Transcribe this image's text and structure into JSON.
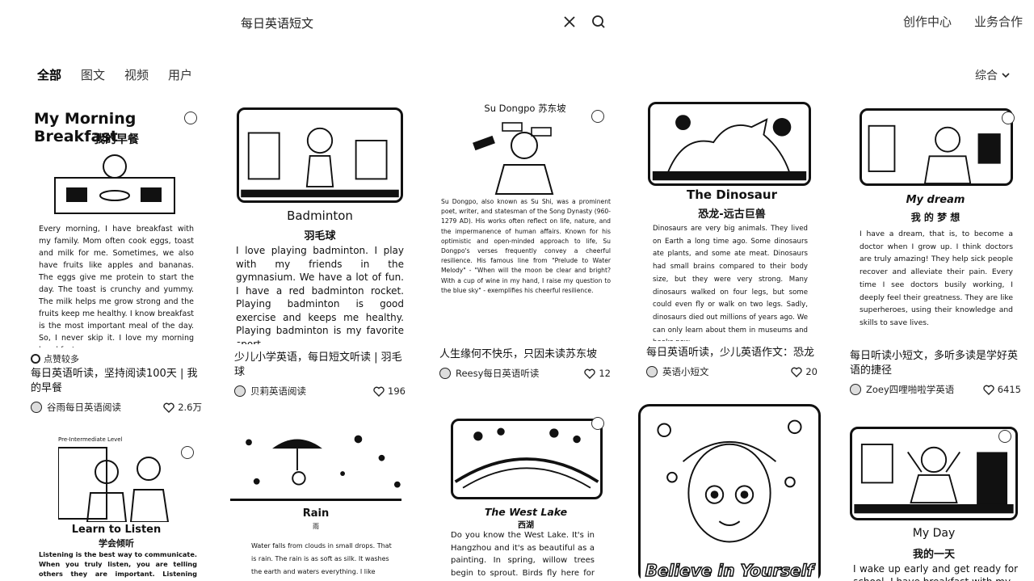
{
  "search": {
    "query": "每日英语短文"
  },
  "header_links": [
    "创作中心",
    "业务合作"
  ],
  "tabs": [
    "全部",
    "图文",
    "视频",
    "用户"
  ],
  "sort": "综合",
  "cards": [
    {
      "img_title": "My Morning Breakfast",
      "img_subtitle": "我的早餐",
      "img_text": "Every morning, I have breakfast with my family. Mom often cook eggs, toast and milk for me. Sometimes, we also have fruits like apples and bananas. The eggs give me protein to start the day. The toast is crunchy and yummy. The milk helps me grow strong and the fruits keep me healthy. I know breakfast is the most important meal of the day. So, I never skip it. I love my morning breakfast.",
      "badge": "点赞较多",
      "caption": "每日英语听读，坚持阅读100天 | 我的早餐",
      "author": "谷雨每日英语阅读",
      "likes": "2.6万"
    },
    {
      "img_title": "Badminton",
      "img_subtitle": "羽毛球",
      "img_text": "I love playing badminton. I play with my friends in the gymnasium. We have a lot of fun. I have a red badminton rocket. Playing badminton is good exercise and keeps me healthy. Playing badminton is my favorite sport.",
      "caption": "少儿小学英语，每日短文听读 | 羽毛球",
      "author": "贝莉英语阅读",
      "likes": "196"
    },
    {
      "img_title": "Su Dongpo  苏东坡",
      "img_text": "Su Dongpo, also known as Su Shi, was a prominent poet, writer, and statesman of the Song Dynasty (960-1279 AD). His works often reflect on life, nature, and the impermanence of human affairs. Known for his optimistic and open-minded approach to life, Su Dongpo's verses frequently convey a cheerful resilience. His famous line from \"Prelude to Water Melody\" - \"When will the moon be clear and bright? With a cup of wine in my hand, I raise my question to the blue sky\" - exemplifies his cheerful resilience.",
      "caption": "人生缘何不快乐，只因未读苏东坡",
      "author": "Reesy每日英语听读",
      "likes": "12"
    },
    {
      "img_title": "The Dinosaur",
      "img_subtitle": "恐龙-远古巨兽",
      "img_text": "Dinosaurs are very big animals. They lived on Earth a long time ago. Some dinosaurs ate plants, and some ate meat. Dinosaurs had small brains compared to their body size, but they were very strong. Many dinosaurs walked on four legs, but some could even fly or walk on two legs. Sadly, dinosaurs died out millions of years ago. We can only learn about them in museums and books now.",
      "caption": "每日英语听读，少儿英语作文：恐龙",
      "author": "英语小短文",
      "likes": "20"
    },
    {
      "img_title": "My dream",
      "img_subtitle": "我 的 梦 想",
      "img_text": "I have a dream, that is, to become a doctor when I grow up. I think doctors are truly amazing! They help sick people recover and alleviate their pain. Every time I see doctors busily working, I deeply feel their greatness. They are like superheroes, using their knowledge and skills to save lives.",
      "caption": "每日听读小短文，多听多读是学好英语的捷径",
      "author": "Zoey四哩啪啦学英语",
      "likes": "6415"
    },
    {
      "img_top": "Pre-Intermediate Level",
      "img_title": "Learn to Listen",
      "img_subtitle": "学会倾听",
      "img_text": "Listening is the best way to communicate. When you truly listen, you are telling others they are important. Listening helps you understand"
    },
    {
      "img_title": "Rain",
      "img_subtitle": "雨",
      "img_text": "Water falls from clouds in small drops. That is rain. The rain is as soft as silk. It washes the earth and waters everything. I like"
    },
    {
      "img_title": "The West Lake",
      "img_subtitle": "西湖",
      "img_text": "Do you know the West Lake. It's in Hangzhou and it's as beautiful as a painting. In spring, willow trees begin to sprout. Birds fly here for the natural"
    },
    {
      "img_title": "Believe in Yourself"
    },
    {
      "img_title": "My Day",
      "img_subtitle": "我的一天",
      "img_text": "I wake up early and get ready for school. I have breakfast with my"
    }
  ]
}
